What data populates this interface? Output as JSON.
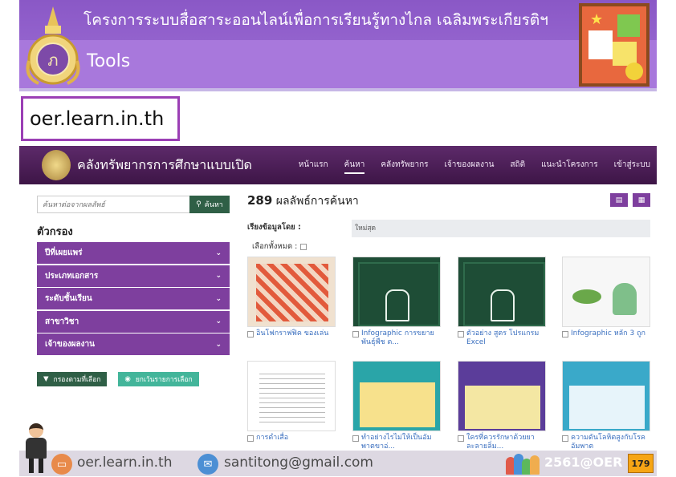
{
  "slide": {
    "title": "โครงการระบบสื่อสาระออนไลน์เพื่อการเรียนรู้ทางไกล เฉลิมพระเกียรติฯ",
    "subtitle": "Tools",
    "url_label": "oer.learn.in.th"
  },
  "site": {
    "name": "คลังทรัพยากรการศึกษาแบบเปิด",
    "nav": [
      {
        "label": "หน้าแรก",
        "active": false
      },
      {
        "label": "ค้นหา",
        "active": true
      },
      {
        "label": "คลังทรัพยากร",
        "active": false
      },
      {
        "label": "เจ้าของผลงาน",
        "active": false
      },
      {
        "label": "สถิติ",
        "active": false
      },
      {
        "label": "แนะนำโครงการ",
        "active": false
      },
      {
        "label": "เข้าสู่ระบบ",
        "active": false
      }
    ],
    "search": {
      "placeholder": "ค้นหาต่อจากผลลัพธ์",
      "button": "ค้นหา"
    },
    "filter_title": "ตัวกรอง",
    "filters": [
      "ปีที่เผยแพร่",
      "ประเภทเอกสาร",
      "ระดับชั้นเรียน",
      "สาขาวิชา",
      "เจ้าของผลงาน"
    ],
    "filter_actions": {
      "apply": "กรองตามที่เลือก",
      "clear": "ยกเว้นรายการเลือก"
    },
    "results": {
      "count": "289",
      "label": "ผลลัพธ์การค้นหา"
    },
    "sort": {
      "label": "เรียงข้อมูลโดย :",
      "value": "ใหม่สุด"
    },
    "select_all": "เลือกทั้งหมด :",
    "items": [
      {
        "caption": "อินโฟกราฟฟิค ของเล่น",
        "thumb": "th-red"
      },
      {
        "caption": "Infographic การขยายพันธุ์พืช ด...",
        "thumb": "th-board"
      },
      {
        "caption": "ตัวอย่าง สูตร โปรแกรม Excel",
        "thumb": "th-board"
      },
      {
        "caption": "Infographic หลัก 3 ถูก",
        "thumb": "th-insect"
      },
      {
        "caption": "การดำเสื่อ",
        "thumb": "th-doc"
      },
      {
        "caption": "ทำอย่างไรไม่ให้เป็นอัมพาตขาอ่...",
        "thumb": "th-teal"
      },
      {
        "caption": "ใครที่ควรรักษาด้วยยาละลายลิ่ม...",
        "thumb": "th-purple"
      },
      {
        "caption": "ความดันโลหิตสูงกับโรคอัมพาต",
        "thumb": "th-teal2"
      }
    ]
  },
  "footer": {
    "website": "oer.learn.in.th",
    "email": "santitong@gmail.com",
    "year": "2561@OER",
    "page": "179"
  },
  "colors": {
    "header_purple": "#9e6fd6",
    "nav_purple": "#4a1d55",
    "filter_purple": "#7e3f9e",
    "button_green": "#2f5f46",
    "link_blue": "#3a6fbf",
    "page_badge": "#f6a515"
  }
}
